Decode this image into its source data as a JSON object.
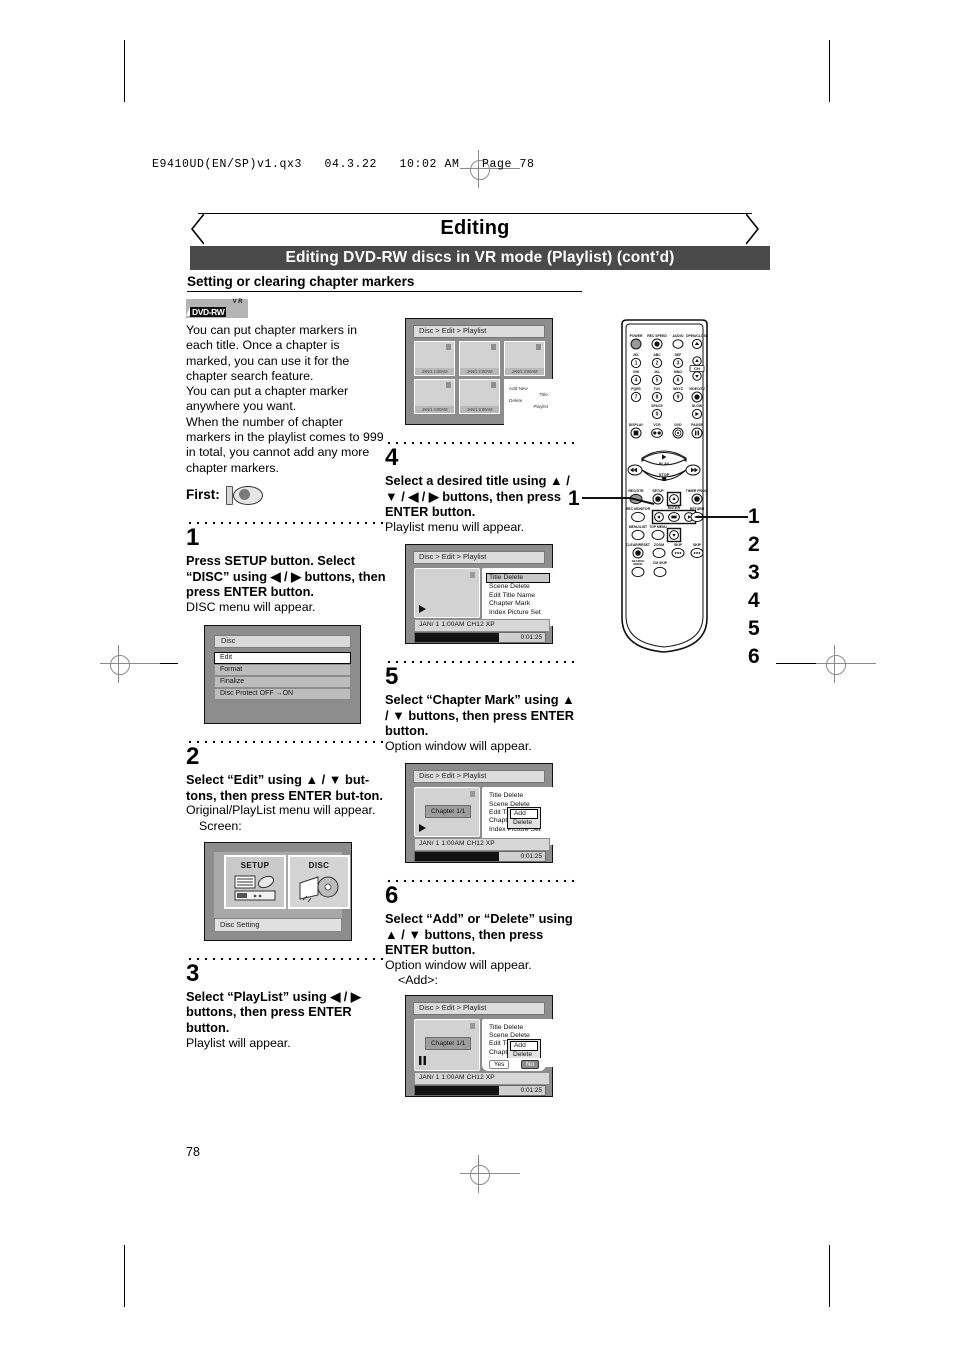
{
  "file_header": "E9410UD(EN/SP)v1.qx3   04.3.22   10:02 AM   Page 78",
  "banner": {
    "title": "Editing"
  },
  "subbanner": {
    "title": "Editing DVD-RW discs in VR mode (Playlist) (cont’d)"
  },
  "section": {
    "heading": "Setting or clearing chapter markers"
  },
  "logo": {
    "vr": "VR",
    "name": "DVD-RW"
  },
  "intro": {
    "paragraphs": [
      "You can put chapter markers in each title. Once a chapter is marked, you can use it for the chapter search feature.",
      "You can put a chapter marker anywhere you want.",
      "When the number of chapter markers in the playlist comes to 999 in total, you cannot add any more chapter markers."
    ],
    "first_label": "First:",
    "first_icon": "disc-insert-icon"
  },
  "steps": [
    {
      "num": "1",
      "bold": "Press SETUP button. Select “DISC” using ◀ / ▶ buttons, then press ENTER button.",
      "light": "DISC menu will appear."
    },
    {
      "num": "2",
      "bold": "Select “Edit” using ▲ / ▼ but-tons, then press ENTER but-ton.",
      "light": "Original/PlayList menu will appear.",
      "light2": "Screen:"
    },
    {
      "num": "3",
      "bold": "Select “PlayList” using ◀ / ▶ buttons, then press ENTER button.",
      "light": "Playlist will appear."
    },
    {
      "num": "4",
      "bold": "Select a desired title using ▲ / ▼ / ◀ / ▶ buttons, then press ENTER button.",
      "light": "Playlist menu will appear."
    },
    {
      "num": "5",
      "bold": "Select “Chapter Mark” using ▲ / ▼ buttons, then press ENTER button.",
      "light": "Option window will appear."
    },
    {
      "num": "6",
      "bold": "Select “Add” or “Delete” using ▲ / ▼ buttons, then press ENTER button.",
      "light": "Option window will appear.",
      "light2": "<Add>:"
    }
  ],
  "disc_menu": {
    "title": "Disc",
    "rows": [
      {
        "label": "Edit",
        "selected": true
      },
      {
        "label": "Format",
        "selected": false
      },
      {
        "label": "Finalize",
        "selected": false
      },
      {
        "label": "Disc Protect OFF →ON",
        "selected": false
      }
    ]
  },
  "icon_screen": {
    "left_label": "SETUP",
    "right_label": "DISC",
    "footer": "Disc Setting"
  },
  "playlist_screen": {
    "breadcrumb": "Disc > Edit > Playlist",
    "thumbs": [
      {
        "num": "1",
        "caption": "JAN/1  1:00AM"
      },
      {
        "num": "2",
        "caption": "JAN/1  2:00AM"
      },
      {
        "num": "3",
        "caption": "JAN/1  3:00AM"
      },
      {
        "num": "4",
        "caption": "JAN/1  4:00AM"
      },
      {
        "num": "5",
        "caption": "JAN/1  5:00AM"
      }
    ],
    "add_new_line1": "Add  New",
    "add_new_line2": "Title",
    "delete_line1": "Delete",
    "delete_line2": "Playlist"
  },
  "title_menu_screen": {
    "breadcrumb": "Disc > Edit > Playlist",
    "menu": [
      {
        "label": "Title Delete",
        "selected": true
      },
      {
        "label": "Scene Delete",
        "selected": false
      },
      {
        "label": "Edit Title Name",
        "selected": false
      },
      {
        "label": "Chapter Mark",
        "selected": false
      },
      {
        "label": "Index Picture Set",
        "selected": false
      }
    ],
    "info": "JAN/ 1  1:00AM  CH12     XP",
    "time": "0:01:25"
  },
  "chapter_mark_screen": {
    "breadcrumb": "Disc > Edit > Playlist",
    "menu": [
      {
        "label": "Title Delete",
        "selected": false
      },
      {
        "label": "Scene Delete",
        "selected": false
      },
      {
        "label": "Edit Title Name",
        "selected": false
      },
      {
        "label": "Chapter Mark",
        "selected": false
      },
      {
        "label": "Index Picture Set",
        "selected": false
      }
    ],
    "popup": [
      {
        "label": "Add",
        "selected": true
      },
      {
        "label": "Delete",
        "selected": false
      }
    ],
    "chapter_label": "Chapter 1/1",
    "info": "JAN/ 1  1:00AM  CH12     XP",
    "time": "0:01:25"
  },
  "add_confirm_screen": {
    "breadcrumb": "Disc > Edit > Playlist",
    "menu": [
      {
        "label": "Title Delete",
        "selected": false
      },
      {
        "label": "Scene Delete",
        "selected": false
      },
      {
        "label": "Edit Title Name",
        "selected": false
      },
      {
        "label": "Chapter Mark",
        "selected": false
      },
      {
        "label": "Index Picture Set",
        "selected": false
      }
    ],
    "popup": [
      {
        "label": "Add",
        "selected": true
      },
      {
        "label": "Delete",
        "selected": false
      }
    ],
    "chapter_label": "Chapter 1/1",
    "yes": "Yes",
    "no": "No",
    "info": "JAN/ 1  1:00AM  CH12     XP",
    "time": "0:01:25"
  },
  "remote": {
    "labels": {
      "power": "POWER",
      "rec_speed": "REC SPEED",
      "audio": "AUDIO",
      "open_close": "OPEN/CLOSE",
      "k1": "JKL",
      "k2": "ABC",
      "k3": "DEF",
      "k4": "GHI",
      "k5": "JKL",
      "k6": "MNO",
      "k7": "PQRS",
      "k8": "TUV",
      "k9": "WXYZ",
      "k0": "SPACE",
      "ch": "CH",
      "videotv": "VIDEO/TV",
      "slow": "SLOW",
      "display": "DISPLAY",
      "vcr": "VCR",
      "dvd": "DVD",
      "pause": "PAUSE",
      "play": "PLAY",
      "stop": "STOP",
      "rec_otr": "REC/OTR",
      "setup": "SETUP",
      "timer_prog": "TIMER PROG.",
      "rec_monitor": "REC MONITOR",
      "enter": "ENTER",
      "return": "RETURN",
      "menu_list": "MENU/LIST",
      "top_menu": "TOP MENU",
      "clear_reset": "CLEAR/RESET",
      "zoom": "ZOOM",
      "skip_b": "SKIP",
      "skip_f": "SKIP",
      "search_mode": "SEARCH MODE",
      "cm_skip": "CM SKIP"
    },
    "callouts_right": [
      "1",
      "2",
      "3",
      "4",
      "5",
      "6"
    ],
    "callout_left": "1"
  },
  "page_number": "78"
}
